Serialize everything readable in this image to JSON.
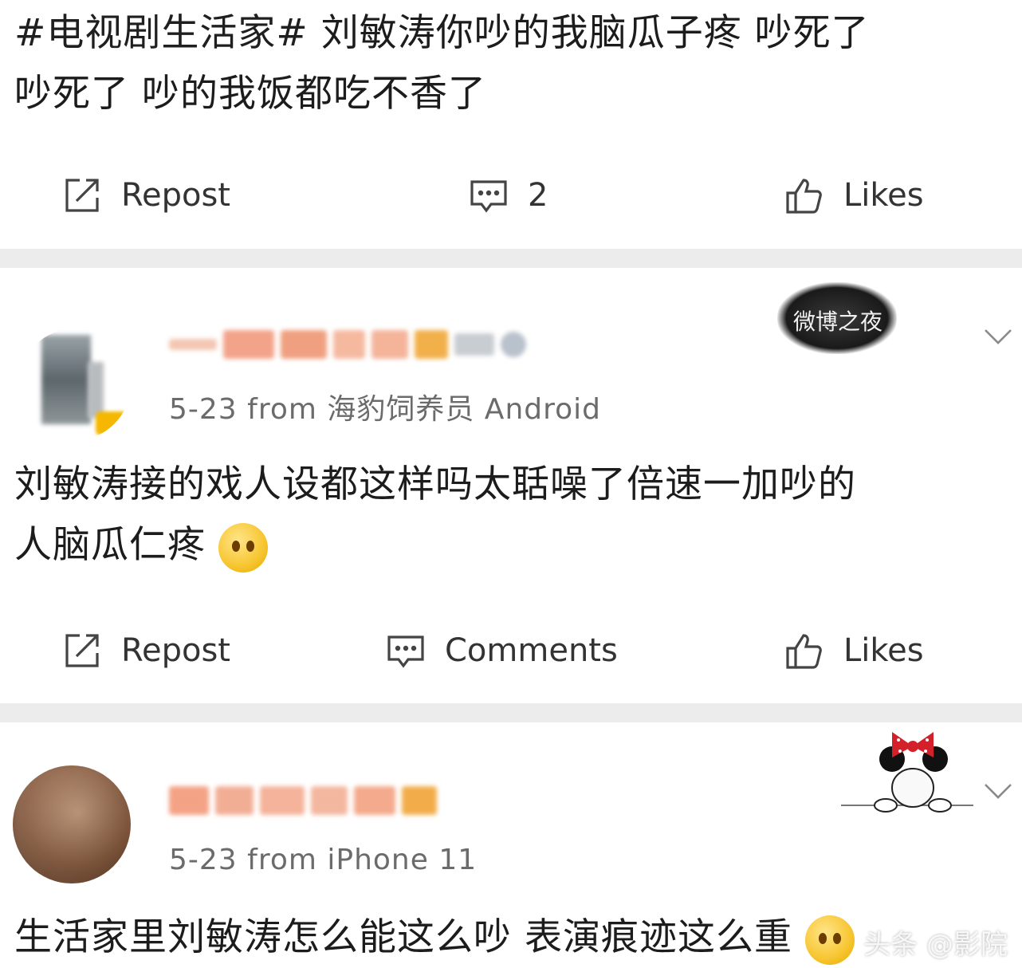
{
  "post1": {
    "hashtag": "#电视剧生活家#",
    "text_line1": " 刘敏涛你吵的我脑瓜子疼  吵死了",
    "text_line2": "吵死了  吵的我饭都吃不香了",
    "actions": {
      "repost": "Repost",
      "comments": "2",
      "likes": "Likes"
    }
  },
  "post2": {
    "meta": "5-23  from 海豹饲养员 Android",
    "badge_text": "微博之夜",
    "text_line1": "刘敏涛接的戏人设都这样吗太聒噪了倍速一加吵的",
    "text_line2": "人脑瓜仁疼",
    "actions": {
      "repost": "Repost",
      "comments": "Comments",
      "likes": "Likes"
    }
  },
  "post3": {
    "meta": "5-23  from iPhone 11",
    "text_line1": "生活家里刘敏涛怎么能这么吵 表演痕迹这么重",
    "watermark": "头条 @影院"
  },
  "colors": {
    "separator": "#ececec",
    "text": "#1c1c1c",
    "meta": "#6b6b6b",
    "icon": "#444444"
  },
  "icons": [
    "repost-icon",
    "comment-icon",
    "like-icon",
    "chevron-down-icon",
    "emoji-icon"
  ]
}
